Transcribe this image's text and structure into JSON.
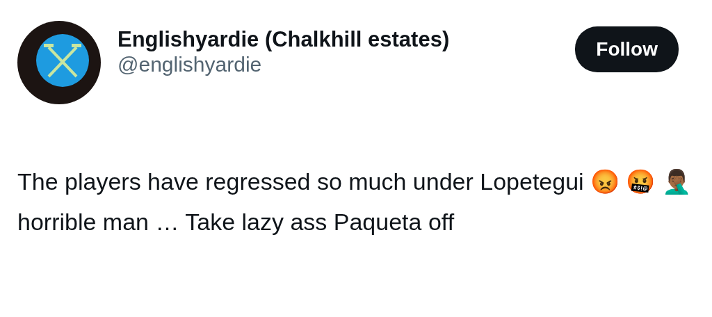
{
  "author": {
    "name": "Englishyardie (Chalkhill estates)",
    "handle": "@englishyardie"
  },
  "follow_button": {
    "label": "Follow"
  },
  "tweet_text": "The players have regressed so much under Lopetegui 😡 🤬 🤦🏾‍♂️ horrible man … Take lazy ass Paqueta off"
}
